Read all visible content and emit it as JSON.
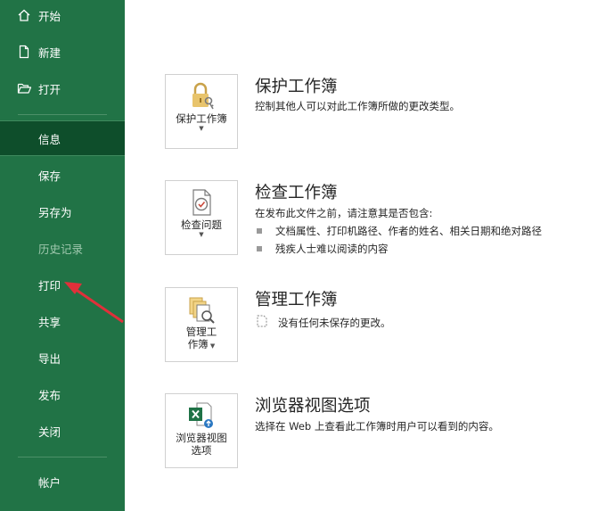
{
  "sidebar": {
    "top_items": [
      {
        "label": "开始",
        "icon": "home-icon"
      },
      {
        "label": "新建",
        "icon": "new-document-icon"
      },
      {
        "label": "打开",
        "icon": "open-folder-icon"
      }
    ],
    "items": [
      {
        "label": "信息",
        "active": true
      },
      {
        "label": "保存"
      },
      {
        "label": "另存为"
      },
      {
        "label": "历史记录",
        "disabled": true
      },
      {
        "label": "打印"
      },
      {
        "label": "共享"
      },
      {
        "label": "导出"
      },
      {
        "label": "发布"
      },
      {
        "label": "关闭"
      }
    ],
    "account": {
      "label": "帐户"
    }
  },
  "sections": {
    "protect": {
      "tile_label": "保护工作簿",
      "title": "保护工作簿",
      "desc": "控制其他人可以对此工作簿所做的更改类型。"
    },
    "inspect": {
      "tile_label": "检查问题",
      "title": "检查工作簿",
      "desc": "在发布此文件之前，请注意其是否包含:",
      "bullets": [
        "文档属性、打印机路径、作者的姓名、相关日期和绝对路径",
        "残疾人士难以阅读的内容"
      ]
    },
    "manage": {
      "tile_label_line1": "管理工",
      "tile_label_line2": "作簿",
      "title": "管理工作簿",
      "desc": "没有任何未保存的更改。"
    },
    "browser": {
      "tile_label_line1": "浏览器视图",
      "tile_label_line2": "选项",
      "title": "浏览器视图选项",
      "desc": "选择在 Web 上查看此工作簿时用户可以看到的内容。"
    }
  },
  "colors": {
    "sidebar_bg": "#217346",
    "sidebar_active_bg": "#0e4e2b",
    "annotation_arrow": "#e0303a"
  }
}
